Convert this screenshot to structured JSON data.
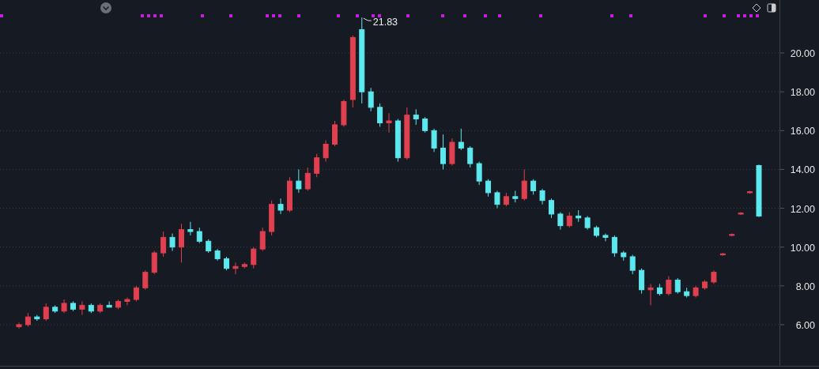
{
  "chart_data": {
    "type": "candlestick",
    "categories": [
      null,
      null,
      null,
      null,
      null,
      null,
      null,
      null,
      null,
      null,
      null,
      null,
      null,
      null,
      null,
      null,
      null,
      null,
      null,
      null,
      null,
      null,
      null,
      null,
      null,
      null,
      null,
      null,
      null,
      null,
      null,
      null,
      null,
      null,
      null,
      null,
      null,
      null,
      null,
      null,
      null,
      null,
      null,
      null,
      null,
      null,
      null,
      null,
      null,
      null,
      null,
      null,
      null,
      null,
      null,
      null,
      null,
      null,
      null,
      null,
      null,
      null,
      null,
      null,
      null,
      null,
      null,
      null,
      null,
      null,
      null,
      null,
      null,
      null,
      null,
      null,
      null,
      null,
      null,
      null,
      null,
      null,
      null
    ],
    "ohlc": [
      [
        5.9,
        6.1,
        5.8,
        6.0
      ],
      [
        6.0,
        6.6,
        5.9,
        6.4
      ],
      [
        6.4,
        6.5,
        6.2,
        6.3
      ],
      [
        6.3,
        7.1,
        6.2,
        6.9
      ],
      [
        6.9,
        7.0,
        6.6,
        6.7
      ],
      [
        6.7,
        7.3,
        6.6,
        7.1
      ],
      [
        7.1,
        7.2,
        6.7,
        6.8
      ],
      [
        6.8,
        7.2,
        6.5,
        7.0
      ],
      [
        7.0,
        7.1,
        6.6,
        6.7
      ],
      [
        6.7,
        7.1,
        6.6,
        7.0
      ],
      [
        7.0,
        7.2,
        6.9,
        6.9
      ],
      [
        6.9,
        7.3,
        6.8,
        7.2
      ],
      [
        7.2,
        7.4,
        7.0,
        7.3
      ],
      [
        7.3,
        8.0,
        7.2,
        7.9
      ],
      [
        7.9,
        8.8,
        7.8,
        8.7
      ],
      [
        8.7,
        9.8,
        8.6,
        9.7
      ],
      [
        9.7,
        10.8,
        9.5,
        10.5
      ],
      [
        10.5,
        10.7,
        9.8,
        10.0
      ],
      [
        10.0,
        11.2,
        9.2,
        10.9
      ],
      [
        10.9,
        11.3,
        10.6,
        10.8
      ],
      [
        10.8,
        11.0,
        10.2,
        10.3
      ],
      [
        10.3,
        10.4,
        9.7,
        9.8
      ],
      [
        9.8,
        9.9,
        9.3,
        9.4
      ],
      [
        9.4,
        9.5,
        8.8,
        8.9
      ],
      [
        8.9,
        9.2,
        8.6,
        9.0
      ],
      [
        9.0,
        9.2,
        8.9,
        9.1
      ],
      [
        9.1,
        10.0,
        8.9,
        9.9
      ],
      [
        9.9,
        11.0,
        9.8,
        10.8
      ],
      [
        10.8,
        12.4,
        10.6,
        12.2
      ],
      [
        12.2,
        12.5,
        11.7,
        11.9
      ],
      [
        11.9,
        13.6,
        11.8,
        13.4
      ],
      [
        13.4,
        14.0,
        12.8,
        13.0
      ],
      [
        13.0,
        14.1,
        12.9,
        13.8
      ],
      [
        13.8,
        14.8,
        13.6,
        14.6
      ],
      [
        14.6,
        15.5,
        14.4,
        15.3
      ],
      [
        15.3,
        16.5,
        15.2,
        16.3
      ],
      [
        16.3,
        17.6,
        16.2,
        17.5
      ],
      [
        17.6,
        20.9,
        17.2,
        20.8
      ],
      [
        21.2,
        21.83,
        17.4,
        18.0
      ],
      [
        18.0,
        18.2,
        17.0,
        17.2
      ],
      [
        17.2,
        17.4,
        16.2,
        16.4
      ],
      [
        16.4,
        16.9,
        15.9,
        16.5
      ],
      [
        16.5,
        16.6,
        14.4,
        14.6
      ],
      [
        14.6,
        17.2,
        14.5,
        16.8
      ],
      [
        16.8,
        17.1,
        16.3,
        16.6
      ],
      [
        16.6,
        16.7,
        15.9,
        16.0
      ],
      [
        16.0,
        16.1,
        14.9,
        15.1
      ],
      [
        15.1,
        15.8,
        14.0,
        14.3
      ],
      [
        14.3,
        15.6,
        14.2,
        15.4
      ],
      [
        15.4,
        16.1,
        15.0,
        15.1
      ],
      [
        15.1,
        15.2,
        14.1,
        14.3
      ],
      [
        14.3,
        14.4,
        13.2,
        13.4
      ],
      [
        13.4,
        13.5,
        12.6,
        12.8
      ],
      [
        12.8,
        12.9,
        12.0,
        12.2
      ],
      [
        12.2,
        12.8,
        12.1,
        12.6
      ],
      [
        12.6,
        12.9,
        12.3,
        12.5
      ],
      [
        12.5,
        14.0,
        12.4,
        13.4
      ],
      [
        13.4,
        13.5,
        12.7,
        12.9
      ],
      [
        12.9,
        13.0,
        12.2,
        12.4
      ],
      [
        12.4,
        12.5,
        11.5,
        11.7
      ],
      [
        11.7,
        11.8,
        10.9,
        11.1
      ],
      [
        11.1,
        11.8,
        11.0,
        11.6
      ],
      [
        11.6,
        11.9,
        11.3,
        11.5
      ],
      [
        11.5,
        11.6,
        10.9,
        11.0
      ],
      [
        11.0,
        11.1,
        10.5,
        10.6
      ],
      [
        10.6,
        10.7,
        10.3,
        10.5
      ],
      [
        10.5,
        10.6,
        9.5,
        9.7
      ],
      [
        9.7,
        9.8,
        9.3,
        9.5
      ],
      [
        9.5,
        9.6,
        8.6,
        8.8
      ],
      [
        8.8,
        8.9,
        7.6,
        7.8
      ],
      [
        7.8,
        8.1,
        7.0,
        7.9
      ],
      [
        7.9,
        8.1,
        7.5,
        7.6
      ],
      [
        7.6,
        8.5,
        7.5,
        8.3
      ],
      [
        8.3,
        8.4,
        7.6,
        7.7
      ],
      [
        7.7,
        7.9,
        7.4,
        7.5
      ],
      [
        7.5,
        8.0,
        7.4,
        7.9
      ],
      [
        7.9,
        8.3,
        7.8,
        8.2
      ],
      [
        8.2,
        8.8,
        8.1,
        8.7
      ],
      [
        9.6,
        9.7,
        9.55,
        9.65
      ],
      [
        10.6,
        10.7,
        10.55,
        10.65
      ],
      [
        11.7,
        11.8,
        11.65,
        11.75
      ],
      [
        12.8,
        12.9,
        12.75,
        12.85
      ],
      [
        14.2,
        14.25,
        11.55,
        11.6
      ]
    ],
    "ylim": [
      3.88,
      22.73
    ],
    "yticks": [
      {
        "value": 20,
        "label": "20.00"
      },
      {
        "value": 18,
        "label": "18.00"
      },
      {
        "value": 16,
        "label": "16.00"
      },
      {
        "value": 14,
        "label": "14.00"
      },
      {
        "value": 12,
        "label": "12.00"
      },
      {
        "value": 10,
        "label": "10.00"
      },
      {
        "value": 8,
        "label": "8.00"
      },
      {
        "value": 6,
        "label": "6.00"
      }
    ],
    "grid": true,
    "annotations": [
      "21.83"
    ]
  }
}
